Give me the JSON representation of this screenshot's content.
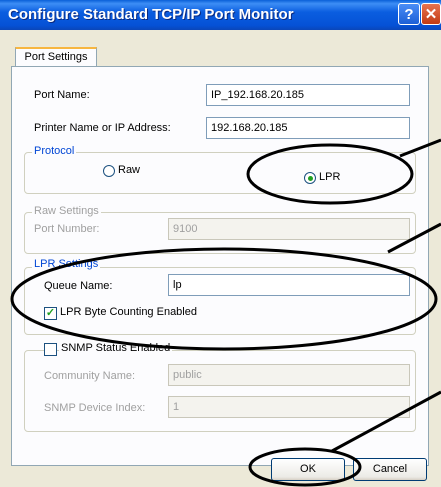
{
  "window": {
    "title": "Configure Standard TCP/IP Port Monitor",
    "help_glyph": "?",
    "close_glyph": "✕"
  },
  "tabs": [
    {
      "label": "Port Settings",
      "selected": true
    }
  ],
  "port": {
    "name_label": "Port Name:",
    "name_value": "IP_192.168.20.185",
    "address_label": "Printer Name or IP Address:",
    "address_value": "192.168.20.185"
  },
  "protocol": {
    "title": "Protocol",
    "options": [
      {
        "label": "Raw",
        "selected": false
      },
      {
        "label": "LPR",
        "selected": true
      }
    ]
  },
  "raw_settings": {
    "title": "Raw Settings",
    "port_number_label": "Port Number:",
    "port_number_value": "9100"
  },
  "lpr_settings": {
    "title": "LPR Settings",
    "queue_label": "Queue Name:",
    "queue_value": "lp",
    "byte_counting_label": "LPR Byte Counting Enabled",
    "byte_counting_checked": true
  },
  "snmp": {
    "status_label": "SNMP Status Enabled",
    "status_checked": false,
    "community_label": "Community Name:",
    "community_value": "public",
    "device_index_label": "SNMP Device Index:",
    "device_index_value": "1"
  },
  "buttons": {
    "ok": "OK",
    "cancel": "Cancel"
  },
  "colors": {
    "titlebar": "#0551d6",
    "group_title": "#0046d5",
    "check": "#21a121",
    "annotation": "#000000"
  }
}
